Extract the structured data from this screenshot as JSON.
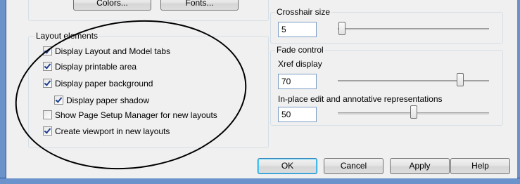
{
  "top_buttons": {
    "colors_label": "Colors...",
    "fonts_label": "Fonts..."
  },
  "layout_elements": {
    "title": "Layout elements",
    "items": [
      {
        "label": "Display Layout and Model tabs",
        "checked": true
      },
      {
        "label": "Display printable area",
        "checked": true
      },
      {
        "label": "Display paper background",
        "checked": true
      },
      {
        "label": "Display paper shadow",
        "checked": true
      },
      {
        "label": "Show Page Setup Manager for new layouts",
        "checked": false
      },
      {
        "label": "Create viewport in new layouts",
        "checked": true
      }
    ]
  },
  "crosshair": {
    "title": "Crosshair size",
    "value": "5"
  },
  "fade_control": {
    "title": "Fade control",
    "xref_label": "Xref display",
    "xref_value": "70",
    "inplace_label": "In-place edit and annotative representations",
    "inplace_value": "50"
  },
  "dialog_buttons": {
    "ok": "OK",
    "cancel": "Cancel",
    "apply": "Apply",
    "help": "Help"
  }
}
